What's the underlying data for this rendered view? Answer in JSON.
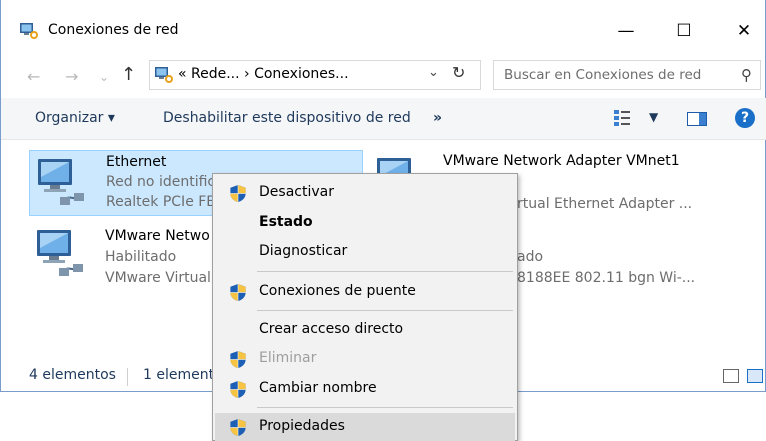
{
  "window": {
    "title": "Conexiones de red",
    "app_icon": "network-connections-icon",
    "controls": {
      "minimize": "—",
      "maximize": "☐",
      "close": "✕"
    }
  },
  "address_bar": {
    "back": "←",
    "forward": "→",
    "recent": "⌄",
    "up": "↑",
    "path": "« Rede... › Conexiones...",
    "dropdown": "⌄",
    "refresh": "↻",
    "search_placeholder": "Buscar en Conexiones de red",
    "search_icon": "⚲"
  },
  "command_bar": {
    "organize": "Organizar ▾",
    "disable_device": "Deshabilitar este dispositivo de red",
    "more": "»",
    "view_dropdown": "▼",
    "help": "?"
  },
  "items": [
    {
      "name": "Ethernet",
      "status": "Red no identific",
      "adapter": "Realtek PCIe FE",
      "selected": true
    },
    {
      "name": "VMware Network Adapter VMnet1",
      "status": "",
      "adapter": "rtual Ethernet Adapter ...",
      "selected": false
    },
    {
      "name": "VMware Netwo",
      "status": "Habilitado",
      "adapter": "VMware Virtual",
      "selected": false
    },
    {
      "name": "",
      "status": "ado",
      "adapter": "8188EE 802.11 bgn Wi-...",
      "selected": false
    }
  ],
  "status_bar": {
    "count": "4 elementos",
    "selected": "1 element"
  },
  "context_menu": {
    "items": [
      {
        "label": "Desactivar",
        "shield": true,
        "bold": false,
        "disabled": false,
        "highlighted": false
      },
      {
        "label": "Estado",
        "shield": false,
        "bold": true,
        "disabled": false,
        "highlighted": false
      },
      {
        "label": "Diagnosticar",
        "shield": false,
        "bold": false,
        "disabled": false,
        "highlighted": false
      },
      {
        "label": "Conexiones de puente",
        "shield": true,
        "bold": false,
        "disabled": false,
        "highlighted": false
      },
      {
        "label": "Crear acceso directo",
        "shield": false,
        "bold": false,
        "disabled": false,
        "highlighted": false
      },
      {
        "label": "Eliminar",
        "shield": true,
        "bold": false,
        "disabled": true,
        "highlighted": false
      },
      {
        "label": "Cambiar nombre",
        "shield": true,
        "bold": false,
        "disabled": false,
        "highlighted": false
      },
      {
        "label": "Propiedades",
        "shield": true,
        "bold": false,
        "disabled": false,
        "highlighted": true
      }
    ]
  },
  "colors": {
    "selection": "#cce8ff",
    "link_text": "#1e395b",
    "secondary_text": "#6d6d6d",
    "menu_bg": "#f2f2f2",
    "menu_highlight": "#dadada"
  }
}
